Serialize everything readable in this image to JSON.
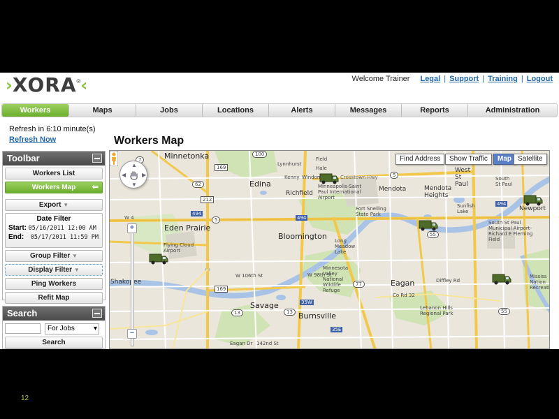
{
  "header": {
    "logo_chev_left": "›",
    "logo_text": "XORA",
    "logo_reg": "®",
    "logo_chev_right": "‹",
    "welcome": "Welcome Trainer",
    "links": [
      "Legal",
      "Support",
      "Training",
      "Logout"
    ],
    "link_separator": "|"
  },
  "nav": {
    "tabs": [
      "Workers",
      "Maps",
      "Jobs",
      "Locations",
      "Alerts",
      "Messages",
      "Reports",
      "Administration"
    ],
    "active": "Workers",
    "accent_color": "#7cbf3c"
  },
  "refresh": {
    "text": "Refresh in 6:10 minute(s)",
    "link": "Refresh Now"
  },
  "page_title": "Workers Map",
  "toolbar": {
    "title": "Toolbar",
    "workers_list": "Workers List",
    "workers_map": "Workers Map",
    "workers_map_arrow": "⇐",
    "export": "Export",
    "date_filter": {
      "title": "Date Filter",
      "start_label": "Start:",
      "start_value": "05/16/2011 12:00 AM",
      "end_label": "End:",
      "end_value": "05/17/2011 11:59 PM"
    },
    "group_filter": "Group Filter",
    "display_filter": "Display Filter",
    "ping_workers": "Ping Workers",
    "refit_map": "Refit Map",
    "caret": "▼"
  },
  "search": {
    "title": "Search",
    "input_value": "",
    "select_value": "For Jobs",
    "button": "Search"
  },
  "map": {
    "controls": [
      "Find Address",
      "Show Traffic",
      "Map",
      "Satellite"
    ],
    "active_control": "Map",
    "zoom_in": "+",
    "zoom_out": "−",
    "pan_arrows": [
      "▲",
      "▼",
      "◀",
      "▶"
    ],
    "places": {
      "minnetonka": "Minnetonka",
      "edina": "Edina",
      "richfield": "Richfield",
      "mpls_airport": "Minneapolis-Saint Paul International Airport",
      "mendota": "Mendota",
      "mendota_heights": "Mendota Heights",
      "west_st_paul": "West St Paul",
      "south_st_paul": "South St Paul",
      "newport": "Newport",
      "eden_prairie": "Eden Prairie",
      "bloomington": "Bloomington",
      "flying_cloud": "Flying Cloud Airport",
      "fort_snelling": "Fort Snelling State Park",
      "long_meadow": "Long Meadow Lake",
      "sunfish_lake": "Sunfish Lake",
      "fleming": "South St Paul Municipal Airport-Richard E Fleming Field",
      "mn_valley": "Minnesota Valley National Wildlife Refuge",
      "eagan": "Eagan",
      "savage": "Savage",
      "burnsville": "Burnsville",
      "shakopee": "Shakopee",
      "lebanon": "Lebanon Hills Regional Park",
      "mississippi": "Mississ Nation Recreati",
      "lynnhurst": "Lynnhurst",
      "kenny": "Kenny",
      "windom": "Windom",
      "field": "Field",
      "hale": "Hale",
      "crosstown": "Crosstown Hwy",
      "w106": "W 106th St",
      "w98": "W 98th St",
      "eagan_dr": "Eagan Dr",
      "w142": "142nd St",
      "co_rd_32": "Co Rd 32",
      "diffley": "Diffley Rd",
      "shield_labels": [
        "7",
        "100",
        "169",
        "62",
        "5",
        "212",
        "494",
        "5",
        "494",
        "494",
        "55",
        "169",
        "77",
        "13",
        "35W",
        "13",
        "35E",
        "55",
        "494",
        "W 4"
      ]
    },
    "truck_count": 5
  },
  "slide_number": "12"
}
